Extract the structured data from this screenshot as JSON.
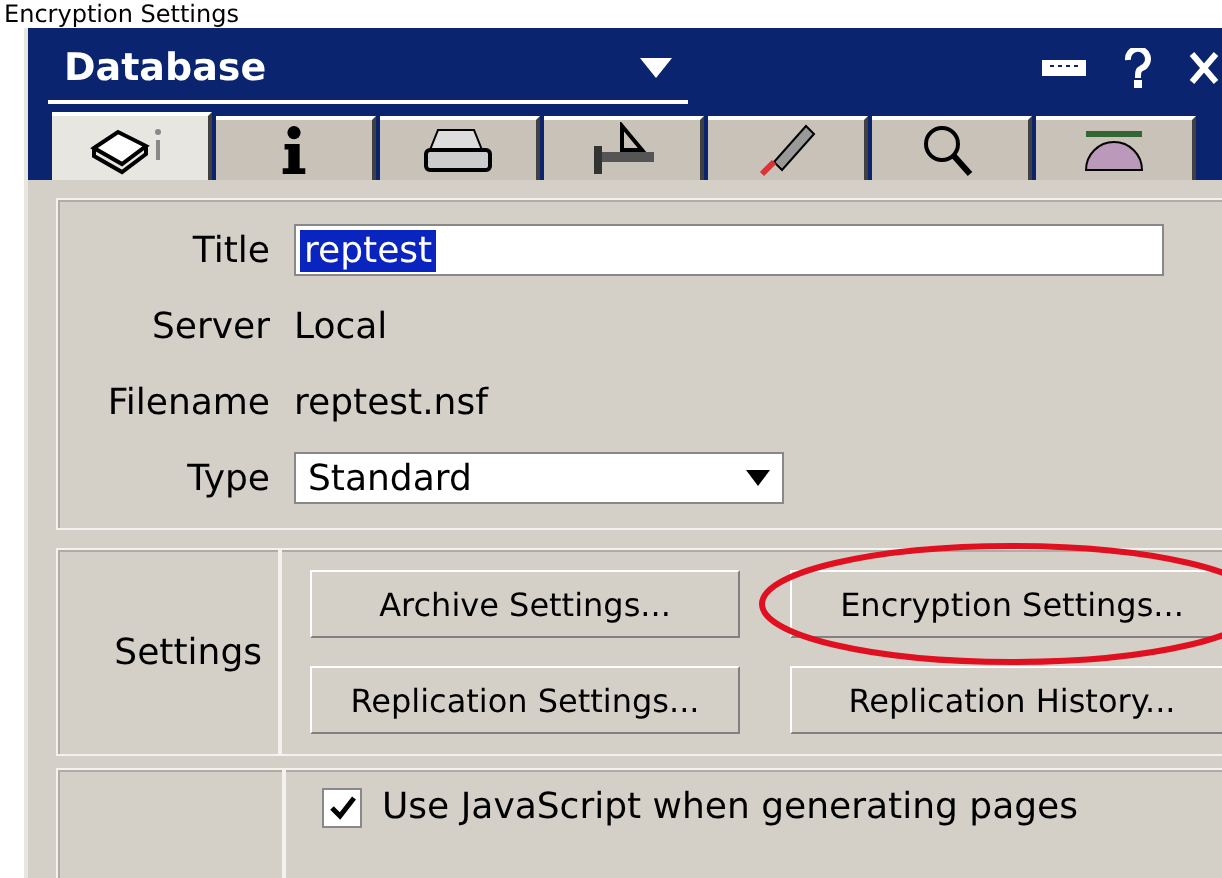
{
  "caption": "Encryption Settings",
  "window": {
    "title": "Database"
  },
  "tabs": [
    {
      "selected": true
    },
    {
      "selected": false
    },
    {
      "selected": false
    },
    {
      "selected": false
    },
    {
      "selected": false
    },
    {
      "selected": false
    },
    {
      "selected": false
    }
  ],
  "fields": [
    {
      "kind": "input",
      "label": "Title",
      "value": "reptest"
    },
    {
      "kind": "text",
      "label": "Server",
      "value": "Local"
    },
    {
      "kind": "text",
      "label": "Filename",
      "value": "reptest.nsf"
    },
    {
      "kind": "select",
      "label": "Type",
      "value": "Standard"
    }
  ],
  "settings": {
    "label": "Settings",
    "buttons": [
      {
        "label": "Archive Settings...",
        "highlighted": false
      },
      {
        "label": "Encryption Settings...",
        "highlighted": true
      },
      {
        "label": "Replication Settings...",
        "highlighted": false
      },
      {
        "label": "Replication History...",
        "highlighted": false
      }
    ]
  },
  "options": [
    {
      "label": "Use JavaScript when generating pages",
      "checked": true
    }
  ]
}
